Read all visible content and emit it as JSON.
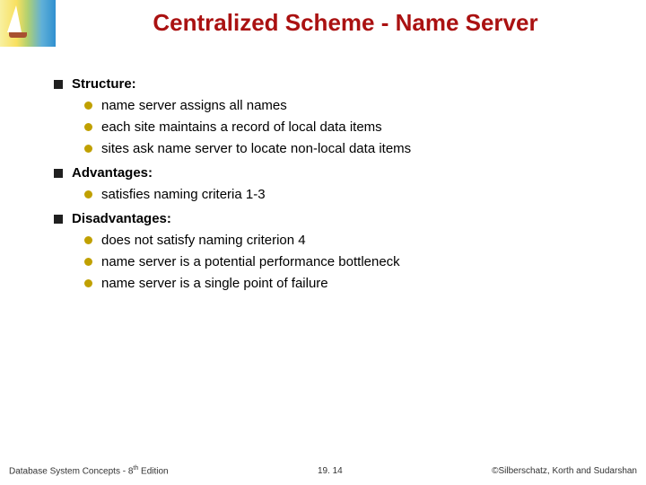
{
  "title": "Centralized Scheme - Name Server",
  "sections": [
    {
      "label": "Structure:",
      "items": [
        "name server assigns all names",
        "each site maintains a record of local data items",
        "sites ask name server to locate non-local data items"
      ]
    },
    {
      "label": "Advantages:",
      "items": [
        "satisfies naming criteria 1-3"
      ]
    },
    {
      "label": "Disadvantages:",
      "items": [
        "does not satisfy naming criterion 4",
        "name server is a potential performance bottleneck",
        "name server is a single point of failure"
      ]
    }
  ],
  "footer": {
    "left_prefix": "Database System Concepts - 8",
    "left_sup": "th",
    "left_suffix": " Edition",
    "center": "19. 14",
    "right": "©Silberschatz, Korth and Sudarshan"
  }
}
